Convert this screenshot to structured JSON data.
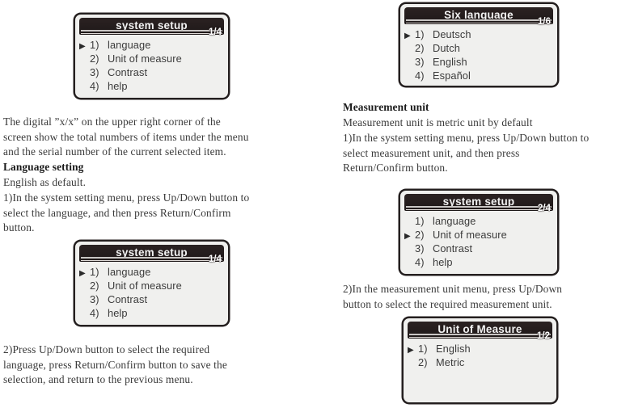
{
  "document": {
    "title": "Scan tool system setup manual page"
  },
  "screens": {
    "system_setup_1": {
      "title": "system setup",
      "count": "1/4",
      "items": [
        {
          "marker": "▶",
          "num": "1)",
          "label": "language"
        },
        {
          "marker": "",
          "num": "2)",
          "label": "Unit of measure"
        },
        {
          "marker": "",
          "num": "3)",
          "label": "Contrast"
        },
        {
          "marker": "",
          "num": "4)",
          "label": "help"
        }
      ]
    },
    "six_language": {
      "title": "Six language",
      "count": "1/6",
      "items": [
        {
          "marker": "▶",
          "num": "1)",
          "label": "Deutsch"
        },
        {
          "marker": "",
          "num": "2)",
          "label": "Dutch"
        },
        {
          "marker": "",
          "num": "3)",
          "label": "English"
        },
        {
          "marker": "",
          "num": "4)",
          "label": "Español"
        }
      ]
    },
    "system_setup_2": {
      "title": "system setup",
      "count": "2/4",
      "items": [
        {
          "marker": "",
          "num": "1)",
          "label": "language"
        },
        {
          "marker": "▶",
          "num": "2)",
          "label": "Unit of measure"
        },
        {
          "marker": "",
          "num": "3)",
          "label": "Contrast"
        },
        {
          "marker": "",
          "num": "4)",
          "label": "help"
        }
      ]
    },
    "system_setup_3": {
      "title": "system setup",
      "count": "1/4",
      "items": [
        {
          "marker": "▶",
          "num": "1)",
          "label": "language"
        },
        {
          "marker": "",
          "num": "2)",
          "label": "Unit of measure"
        },
        {
          "marker": "",
          "num": "3)",
          "label": "Contrast"
        },
        {
          "marker": "",
          "num": "4)",
          "label": "help"
        }
      ]
    },
    "unit_of_measure": {
      "title": "Unit of Measure",
      "count": "1/2",
      "items": [
        {
          "marker": "▶",
          "num": "1)",
          "label": "English"
        },
        {
          "marker": "",
          "num": "2)",
          "label": "Metric"
        }
      ]
    }
  },
  "left_column": {
    "digital_note": "The digital  ”x/x”  on the upper right corner of  the\nscreen show the total numbers of  items under the menu\nand the serial number of  the current selected item.",
    "language_heading": "Language setting",
    "english_default": "English as default.",
    "step_1": "1)In the system setting menu, press Up/Down button to\nselect the language, and then press Return/Confirm\nbutton.",
    "step_2": "2)Press Up/Down button to select the required\nlanguage, press Return/Confirm button to save the\nselection, and return to the previous menu."
  },
  "right_column": {
    "measurement_heading": "Measurement unit",
    "measurement_default": "Measurement unit is metric unit by default",
    "step_1": "1)In the system setting menu, press Up/Down button to\nselect measurement unit, and then press\nReturn/Confirm button.",
    "step_2": "2)In the measurement unit menu, press Up/Down\nbutton to select the required measurement unit."
  },
  "colors": {
    "lcd_bezel": "#241f1f",
    "lcd_screen": "#f0f0ee",
    "lcd_titlebar": "#241c1c",
    "title_text": "#f2f2f2",
    "body_text": "#3a3a3a"
  }
}
